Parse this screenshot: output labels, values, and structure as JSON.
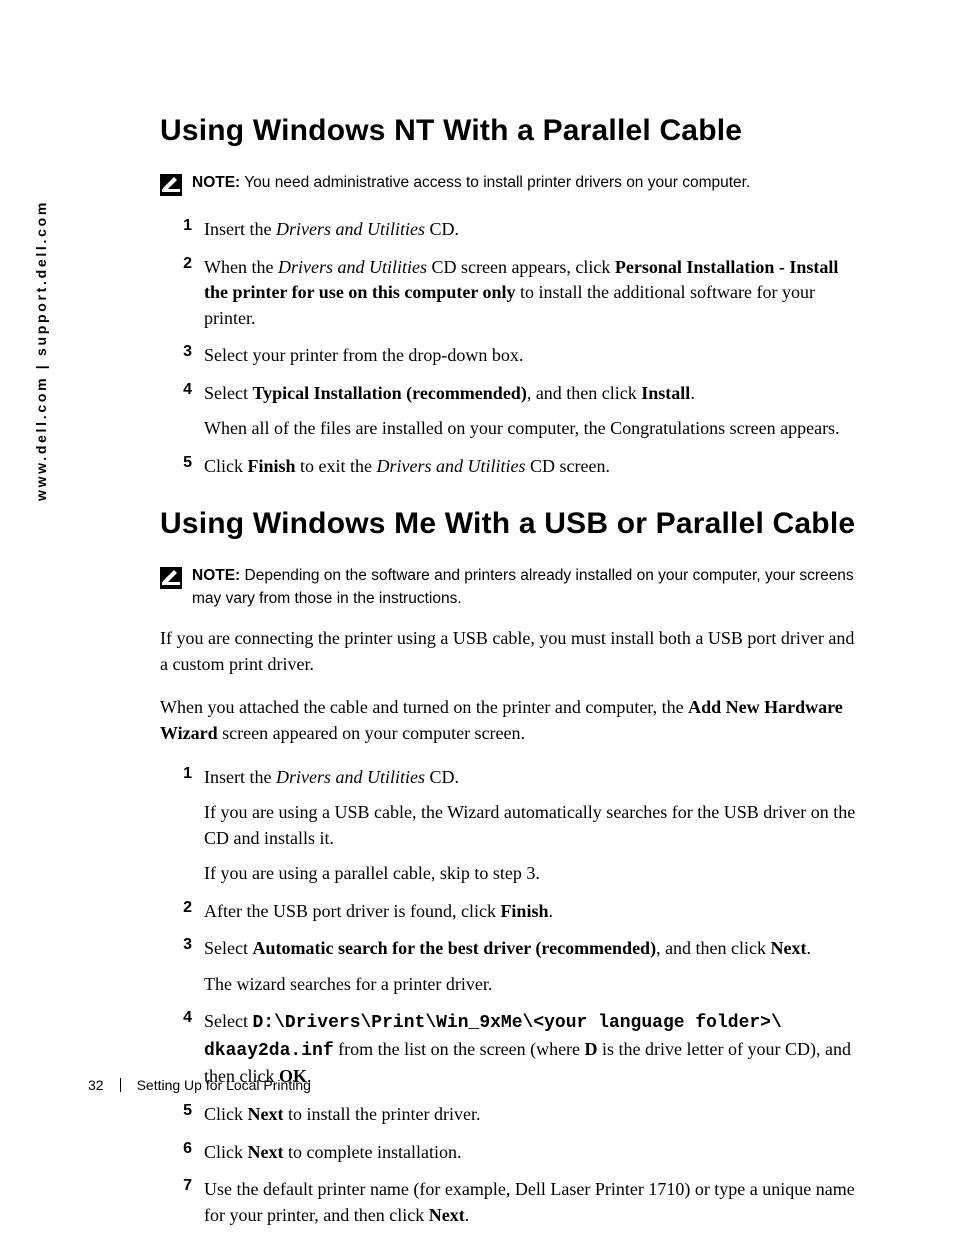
{
  "sidebar_url": "www.dell.com | support.dell.com",
  "section1": {
    "heading": "Using Windows NT With a Parallel Cable",
    "note_label": "NOTE:",
    "note_text": " You need administrative access to install printer drivers on your computer.",
    "steps": {
      "s1": {
        "a": "Insert the ",
        "b": "Drivers and Utilities",
        "c": " CD."
      },
      "s2": {
        "a": "When the ",
        "b": "Drivers and Utilities",
        "c": " CD screen appears, click ",
        "d": "Personal Installation - Install the printer for use on this computer only",
        "e": " to install the additional software for your printer."
      },
      "s3": "Select your printer from the drop-down box.",
      "s4": {
        "a": "Select ",
        "b": "Typical Installation (recommended)",
        "c": ", and then click ",
        "d": "Install",
        "e": ".",
        "p2": "When all of the files are installed on your computer, the Congratulations screen appears."
      },
      "s5": {
        "a": "Click ",
        "b": "Finish",
        "c": " to exit the ",
        "d": "Drivers and Utilities",
        "e": " CD screen."
      }
    }
  },
  "section2": {
    "heading": "Using Windows Me With a USB or Parallel Cable",
    "note_label": "NOTE:",
    "note_text": " Depending on the software and printers already installed on your computer, your screens may vary from those in the instructions.",
    "para1": "If you are connecting the printer using a USB cable, you must install both a USB port driver and a custom print driver.",
    "para2": {
      "a": "When you attached the cable and turned on the printer and computer, the ",
      "b": "Add New Hardware Wizard",
      "c": " screen appeared on your computer screen."
    },
    "steps": {
      "s1": {
        "a": "Insert the ",
        "b": "Drivers and Utilities",
        "c": " CD.",
        "p2": "If you are using a USB cable, the Wizard automatically searches for the USB driver on the CD and installs it.",
        "p3": "If you are using a parallel cable, skip to step 3."
      },
      "s2": {
        "a": "After the USB port driver is found, click ",
        "b": "Finish",
        "c": "."
      },
      "s3": {
        "a": "Select ",
        "b": "Automatic search for the best driver (recommended)",
        "c": ", and then click ",
        "d": "Next",
        "e": ".",
        "p2": "The wizard searches for a printer driver."
      },
      "s4": {
        "a": "Select ",
        "b": "D:\\Drivers\\Print\\Win_9xMe\\<your language folder>\\ dkaay2da.inf",
        "c": " from the list on the screen (where ",
        "d": "D",
        "e": " is the drive letter of your CD), and then click ",
        "f": "OK",
        "g": "."
      },
      "s5": {
        "a": "Click ",
        "b": "Next",
        "c": " to install the printer driver."
      },
      "s6": {
        "a": "Click ",
        "b": "Next",
        "c": " to complete installation."
      },
      "s7": {
        "a": "Use the default printer name (for example, Dell Laser Printer 1710) or type a unique name for your printer, and then click ",
        "b": "Next",
        "c": "."
      }
    }
  },
  "footer": {
    "page": "32",
    "section": "Setting Up for Local Printing"
  }
}
